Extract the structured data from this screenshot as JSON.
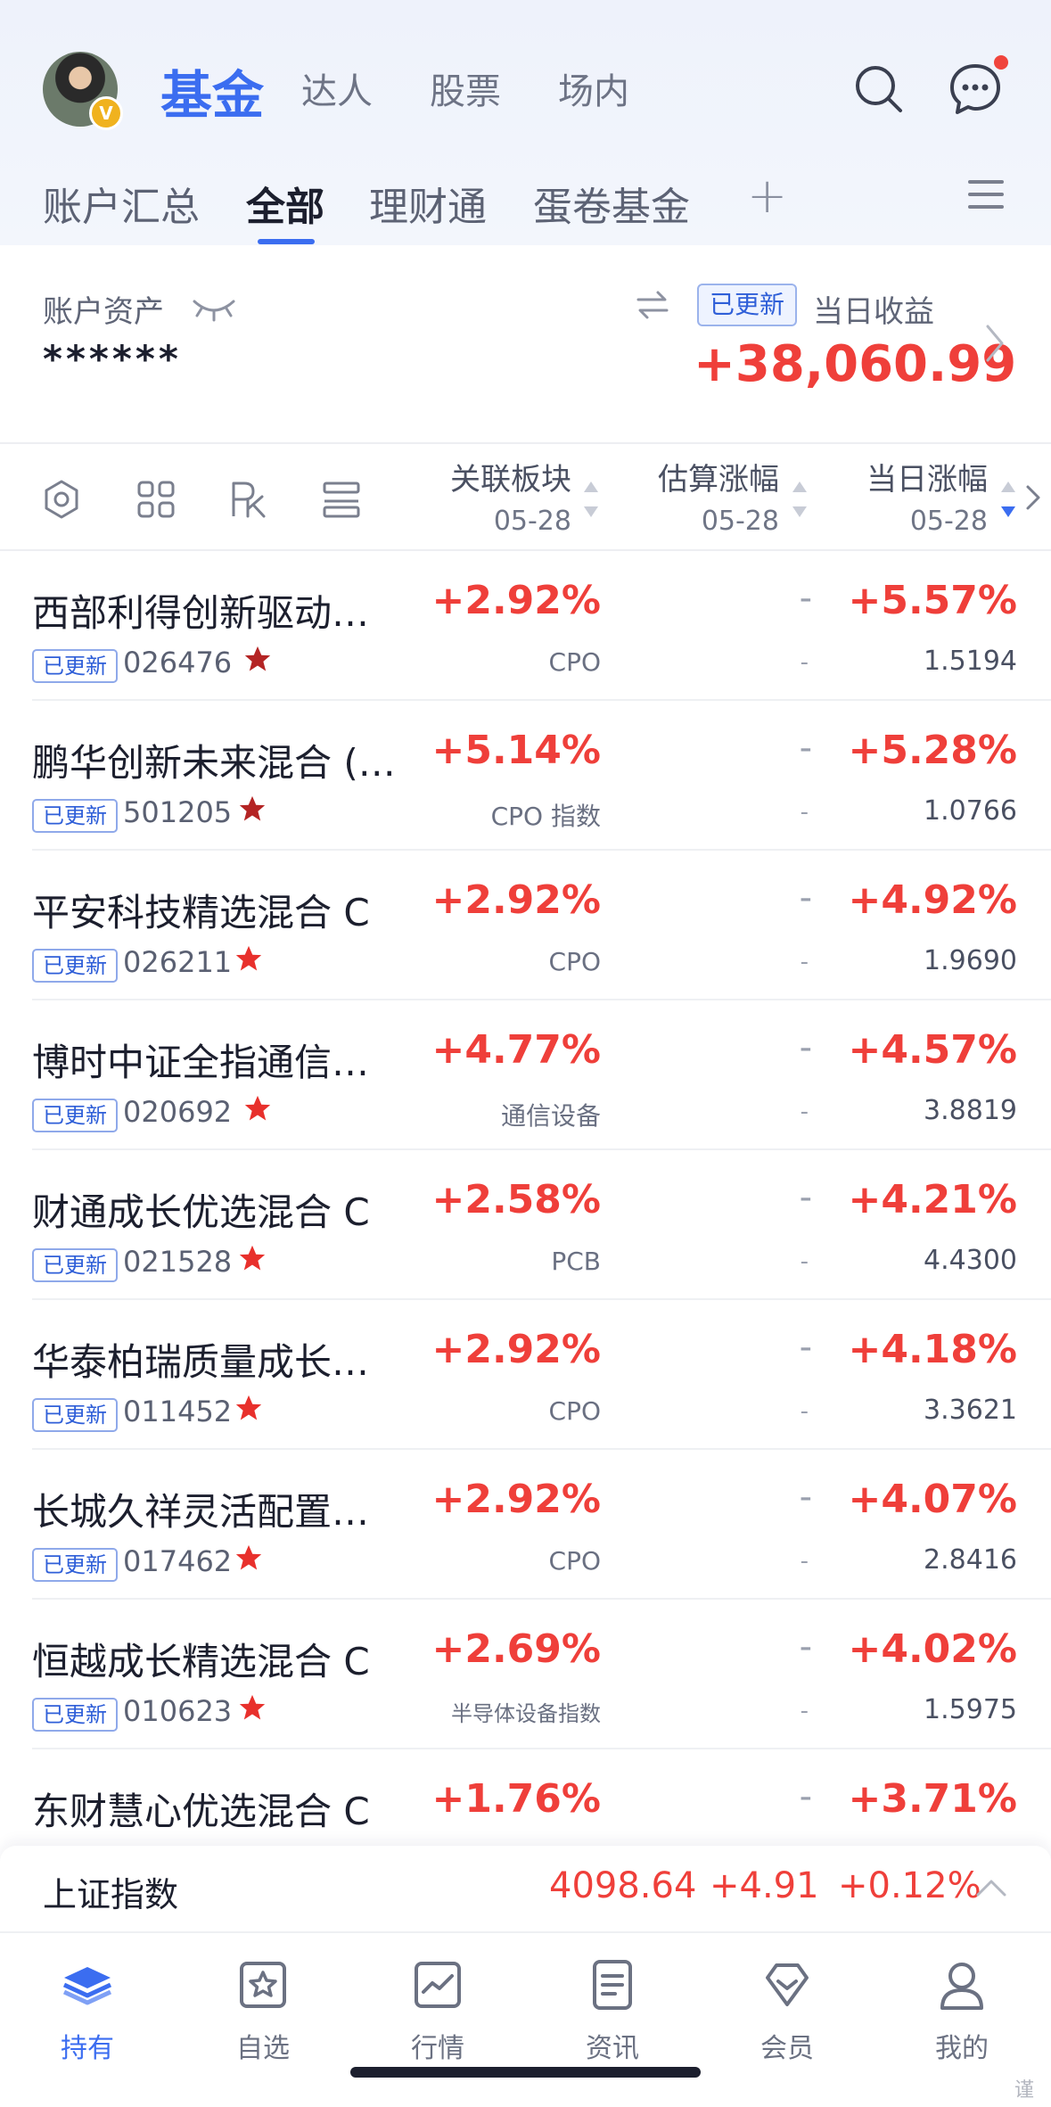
{
  "header": {
    "top_tabs": [
      {
        "label": "基金",
        "active": true
      },
      {
        "label": "达人",
        "active": false
      },
      {
        "label": "股票",
        "active": false
      },
      {
        "label": "场内",
        "active": false
      }
    ],
    "avatar_badge": "V",
    "sub_tabs": [
      {
        "label": "账户汇总",
        "active": false
      },
      {
        "label": "全部",
        "active": true
      },
      {
        "label": "理财通",
        "active": false
      },
      {
        "label": "蛋卷基金",
        "active": false
      }
    ],
    "add_label": "+"
  },
  "summary": {
    "assets_label": "账户资产",
    "assets_value": "******",
    "updated_badge": "已更新",
    "daily_label": "当日收益",
    "daily_value": "+38,060.99"
  },
  "columns": [
    {
      "title": "关联板块",
      "date": "05-28"
    },
    {
      "title": "估算涨幅",
      "date": "05-28"
    },
    {
      "title": "当日涨幅",
      "date": "05-28"
    }
  ],
  "funds": [
    {
      "name": "西部利得创新驱动…",
      "badge": "已更新",
      "code": "026476",
      "sector_pct": "+2.92%",
      "sector": "CPO",
      "est": "-",
      "est_sub": "-",
      "day_pct": "+5.57%",
      "nav": "1.5194"
    },
    {
      "name": "鹏华创新未来混合 (…",
      "badge": "已更新",
      "code": "501205",
      "sector_pct": "+5.14%",
      "sector": "CPO 指数",
      "est": "-",
      "est_sub": "-",
      "day_pct": "+5.28%",
      "nav": "1.0766"
    },
    {
      "name": "平安科技精选混合 C",
      "badge": "已更新",
      "code": "026211",
      "sector_pct": "+2.92%",
      "sector": "CPO",
      "est": "-",
      "est_sub": "-",
      "day_pct": "+4.92%",
      "nav": "1.9690"
    },
    {
      "name": "博时中证全指通信…",
      "badge": "已更新",
      "code": "020692",
      "sector_pct": "+4.77%",
      "sector": "通信设备",
      "est": "-",
      "est_sub": "-",
      "day_pct": "+4.57%",
      "nav": "3.8819"
    },
    {
      "name": "财通成长优选混合 C",
      "badge": "已更新",
      "code": "021528",
      "sector_pct": "+2.58%",
      "sector": "PCB",
      "est": "-",
      "est_sub": "-",
      "day_pct": "+4.21%",
      "nav": "4.4300"
    },
    {
      "name": "华泰柏瑞质量成长…",
      "badge": "已更新",
      "code": "011452",
      "sector_pct": "+2.92%",
      "sector": "CPO",
      "est": "-",
      "est_sub": "-",
      "day_pct": "+4.18%",
      "nav": "3.3621"
    },
    {
      "name": "长城久祥灵活配置…",
      "badge": "已更新",
      "code": "017462",
      "sector_pct": "+2.92%",
      "sector": "CPO",
      "est": "-",
      "est_sub": "-",
      "day_pct": "+4.07%",
      "nav": "2.8416"
    },
    {
      "name": "恒越成长精选混合 C",
      "badge": "已更新",
      "code": "010623",
      "sector_pct": "+2.69%",
      "sector": "半导体设备指数",
      "est": "-",
      "est_sub": "-",
      "day_pct": "+4.02%",
      "nav": "1.5975"
    },
    {
      "name": "东财慧心优选混合 C",
      "badge": "",
      "code": "",
      "sector_pct": "+1.76%",
      "sector": "",
      "est": "-",
      "est_sub": "",
      "day_pct": "+3.71%",
      "nav": ""
    }
  ],
  "index_bar": {
    "name": "上证指数",
    "value": "4098.64",
    "change": "+4.91",
    "change_pct": "+0.12%"
  },
  "tabbar": [
    {
      "label": "持有",
      "icon": "layers-icon",
      "active": true
    },
    {
      "label": "自选",
      "icon": "star-box-icon",
      "active": false
    },
    {
      "label": "行情",
      "icon": "chart-icon",
      "active": false
    },
    {
      "label": "资讯",
      "icon": "document-icon",
      "active": false
    },
    {
      "label": "会员",
      "icon": "diamond-icon",
      "active": false
    },
    {
      "label": "我的",
      "icon": "person-icon",
      "active": false
    }
  ],
  "watermark": "谨",
  "colors": {
    "accent": "#3b6df0",
    "up": "#ef3f3a",
    "star": "#d42c2c"
  }
}
